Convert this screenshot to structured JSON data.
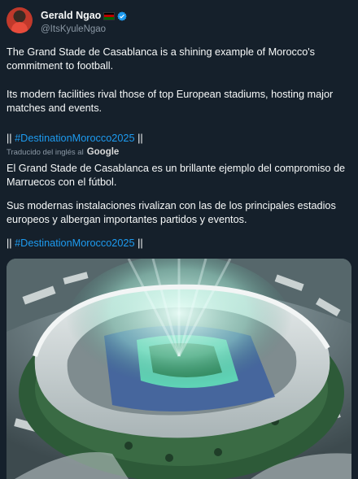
{
  "author": {
    "name": "Gerald Ngao",
    "handle": "@ItsKyuleNgao"
  },
  "tweet": {
    "p1": "The Grand Stade de Casablanca is a shining example of Morocco's commitment to football.",
    "p2": "Its modern facilities rival those of top European stadiums, hosting major matches and events.",
    "hashtag": "#DestinationMorocco2025",
    "bars_left": "||",
    "bars_right": "||"
  },
  "translation": {
    "label": "Traducido del inglés al",
    "provider": "Google",
    "p1": "El Grand Stade de Casablanca es un brillante ejemplo del compromiso de Marruecos con el fútbol.",
    "p2": "Sus modernas instalaciones rivalizan con las de los principales estadios europeos y albergan importantes partidos y eventos.",
    "hashtag": "#DestinationMorocco2025",
    "bars_left": "||",
    "bars_right": "||"
  },
  "colors": {
    "background": "#15202b",
    "link": "#1d9bf0",
    "muted": "#8b98a5",
    "verified": "#1d9bf0"
  }
}
